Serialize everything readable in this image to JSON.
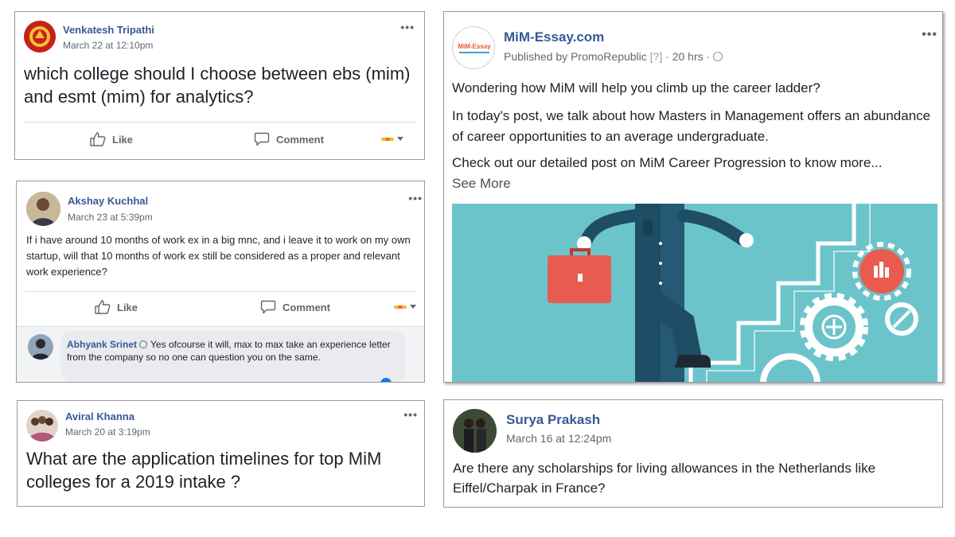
{
  "posts": [
    {
      "author": "Venkatesh Tripathi",
      "time": "March 22 at 12:10pm",
      "text": "which college should I choose between ebs (mim) and esmt (mim) for analytics?",
      "like_label": "Like",
      "comment_label": "Comment"
    },
    {
      "author": "Akshay Kuchhal",
      "time": "March 23 at 5:39pm",
      "text": "If i have around 10 months of work ex in a big mnc, and i leave it to work on my own startup, will that 10 months of work ex still be considered as a proper and relevant work experience?",
      "like_label": "Like",
      "comment_label": "Comment",
      "reply": {
        "author": "Abhyank Srinet",
        "text": "Yes ofcourse it will, max to max take an experience letter from the company so no one can question you on the same."
      }
    },
    {
      "author": "Aviral Khanna",
      "time": "March 20 at 3:19pm",
      "text": "What are the application timelines for top MiM colleges for a 2019 intake ?"
    },
    {
      "author": "MiM-Essay.com",
      "published_prefix": "Published by",
      "publisher": "PromoRepublic",
      "publisher_suffix": "[?]",
      "time": "20 hrs",
      "logo_text": "MiM-Essay",
      "para1": "Wondering how MiM will help you climb up the career ladder?",
      "para2": "In today's post, we talk about how Masters in Management offers an abundance of career opportunities to an average undergraduate.",
      "para3": "Check out our detailed post on MiM Career Progression to know more...",
      "see_more": "See More"
    },
    {
      "author": "Surya Prakash",
      "time": "March 16 at 12:24pm",
      "text": "Are there any scholarships for living allowances in the Netherlands like Eiffel/Charpak in France?"
    }
  ],
  "colors": {
    "name_blue": "#385898",
    "illustration_bg": "#6cc4cb",
    "bag_red": "#e85c4f"
  }
}
